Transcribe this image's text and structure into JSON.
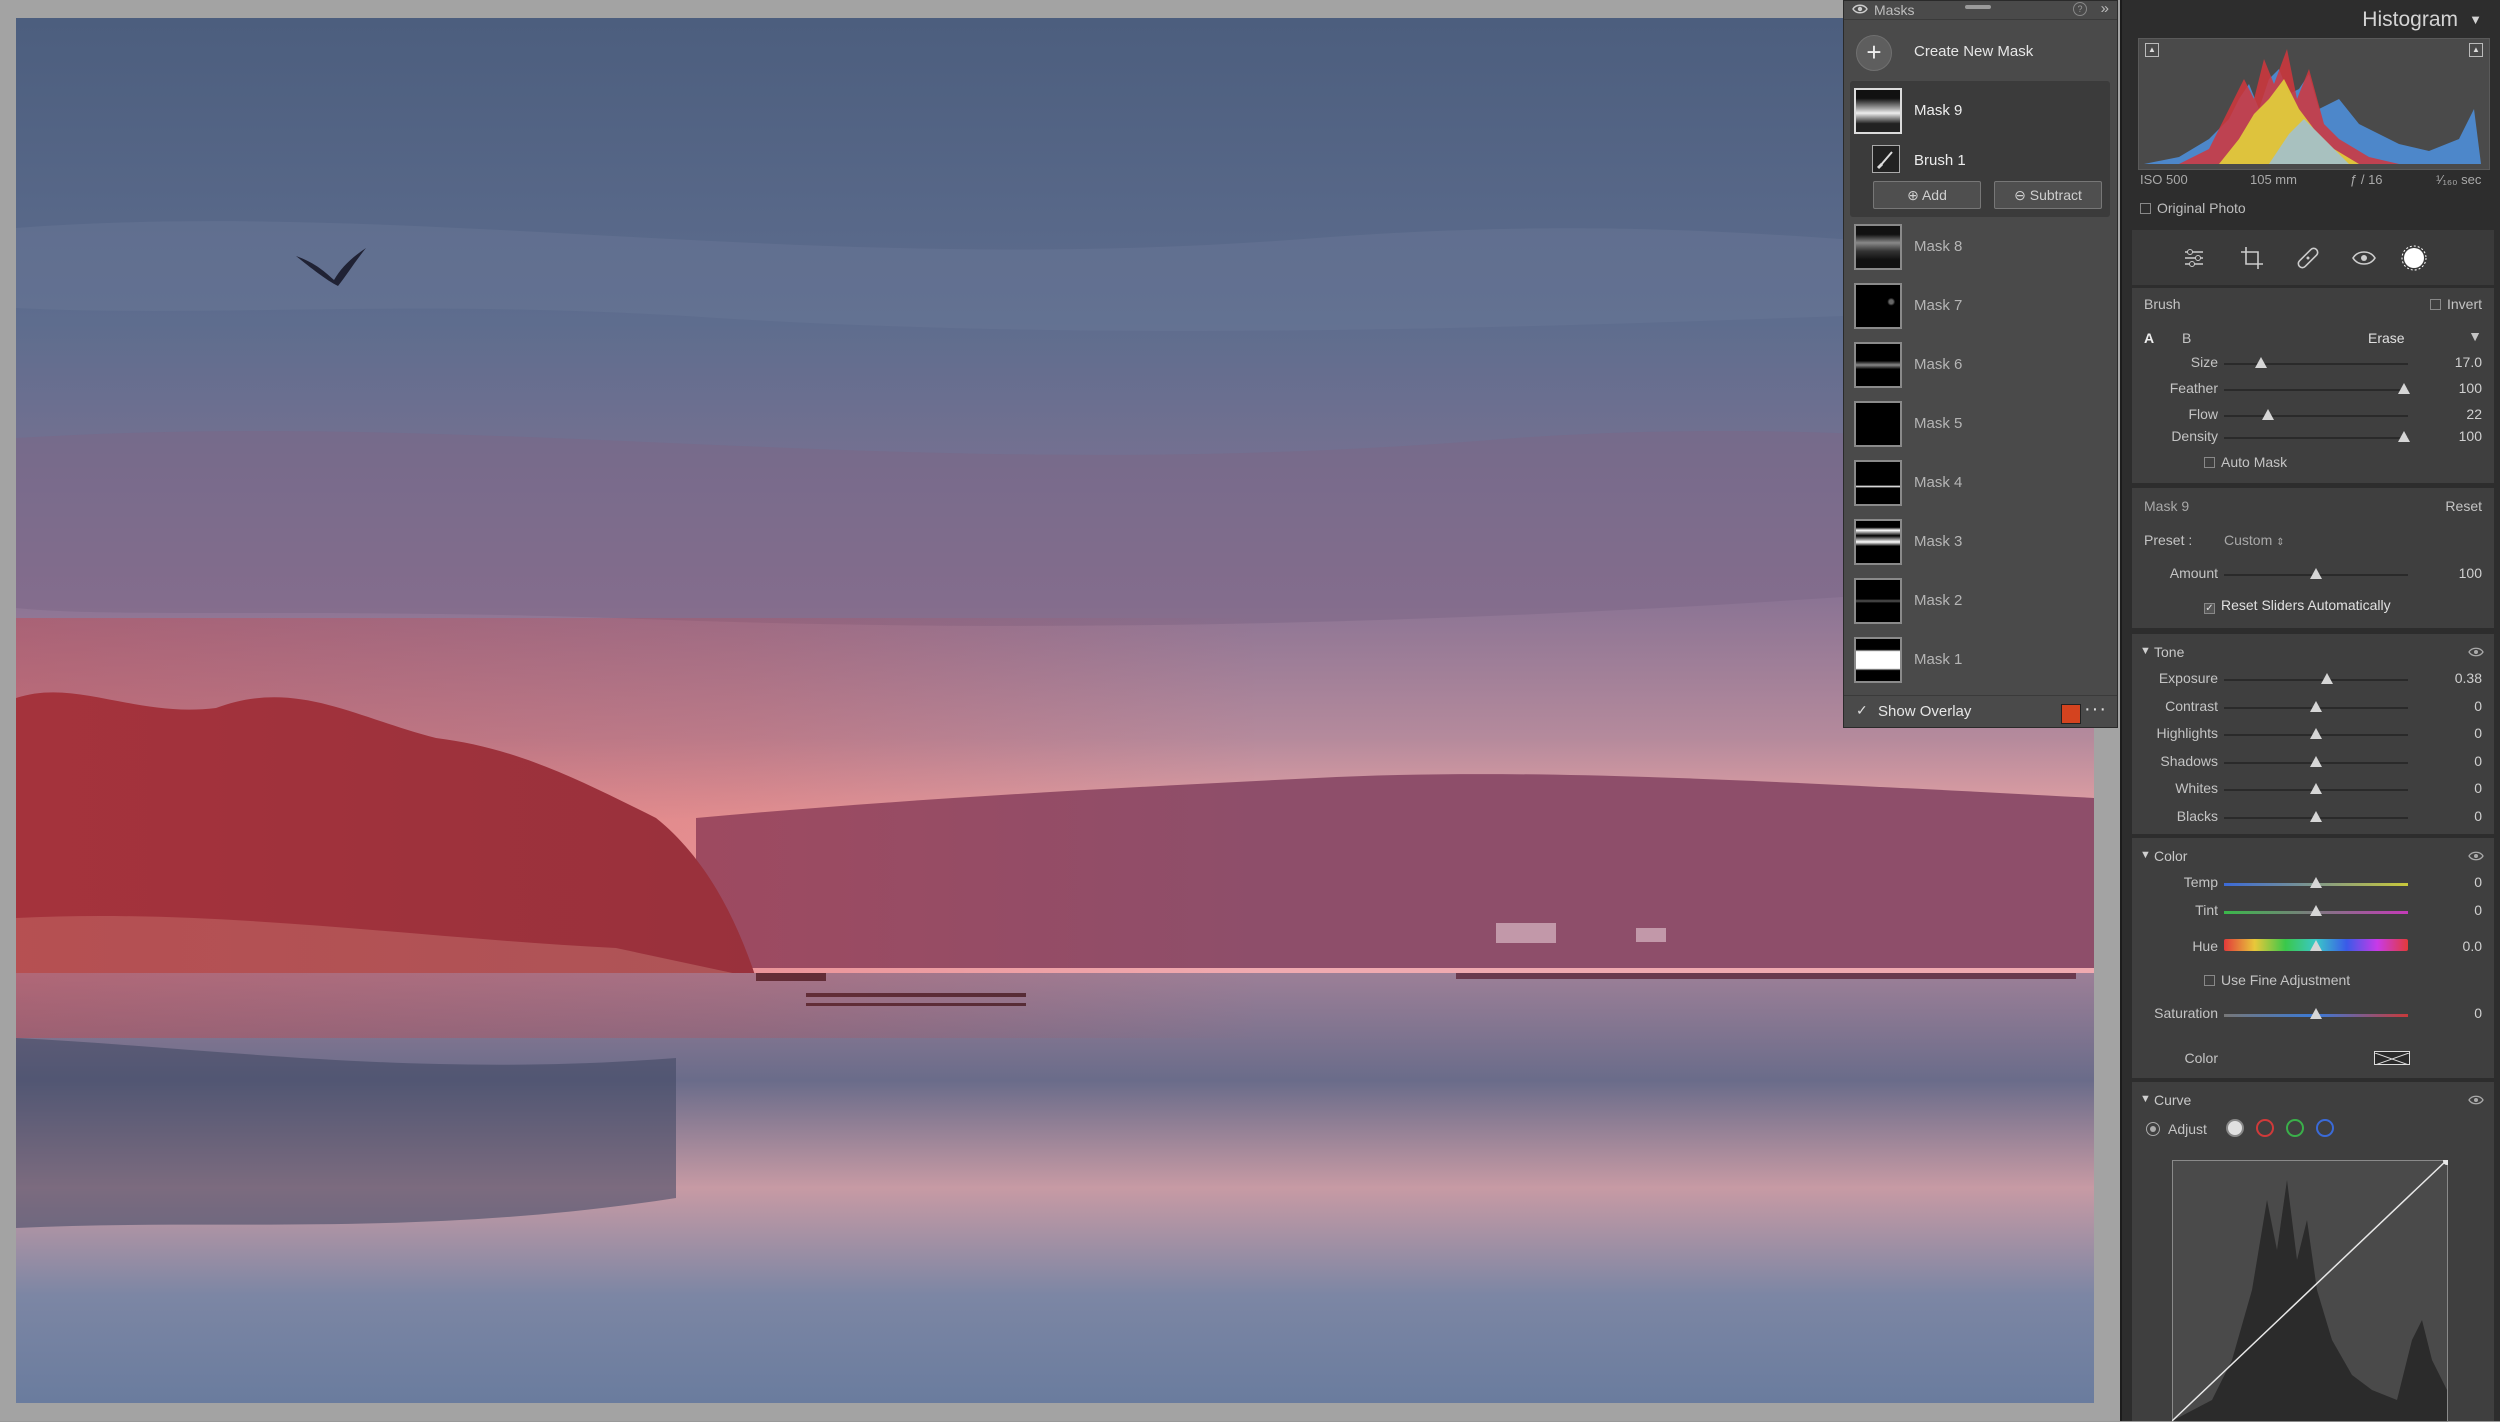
{
  "masks_panel": {
    "title": "Masks",
    "create_label": "Create New Mask",
    "selected_mask": "Mask 9",
    "brush_label": "Brush 1",
    "add_label": "Add",
    "subtract_label": "Subtract",
    "masks": [
      "Mask 8",
      "Mask 7",
      "Mask 6",
      "Mask 5",
      "Mask 4",
      "Mask 3",
      "Mask 2",
      "Mask 1"
    ],
    "show_overlay_label": "Show Overlay",
    "overlay_color": "#d4431f",
    "more_label": "···"
  },
  "histogram": {
    "title": "Histogram",
    "iso": "ISO 500",
    "focal": "105 mm",
    "aperture": "ƒ / 16",
    "shutter": "¹⁄₁₆₀ sec",
    "original_photo_label": "Original Photo"
  },
  "brush": {
    "title": "Brush",
    "invert_label": "Invert",
    "tab_a": "A",
    "tab_b": "B",
    "erase_label": "Erase",
    "size_label": "Size",
    "size_value": "17.0",
    "size_pos": 0.2,
    "feather_label": "Feather",
    "feather_value": "100",
    "feather_pos": 0.98,
    "flow_label": "Flow",
    "flow_value": "22",
    "flow_pos": 0.24,
    "density_label": "Density",
    "density_value": "100",
    "density_pos": 0.98,
    "auto_mask_label": "Auto Mask"
  },
  "mask_settings": {
    "name": "Mask 9",
    "reset_label": "Reset",
    "preset_label": "Preset :",
    "preset_value": "Custom",
    "amount_label": "Amount",
    "amount_value": "100",
    "reset_sliders_label": "Reset Sliders Automatically"
  },
  "tone": {
    "title": "Tone",
    "sliders": [
      {
        "label": "Exposure",
        "value": "0.38"
      },
      {
        "label": "Contrast",
        "value": "0"
      },
      {
        "label": "Highlights",
        "value": "0"
      },
      {
        "label": "Shadows",
        "value": "0"
      },
      {
        "label": "Whites",
        "value": "0"
      },
      {
        "label": "Blacks",
        "value": "0"
      }
    ]
  },
  "color": {
    "title": "Color",
    "temp_label": "Temp",
    "temp_value": "0",
    "tint_label": "Tint",
    "tint_value": "0",
    "hue_label": "Hue",
    "hue_value": "0.0",
    "fine_label": "Use Fine Adjustment",
    "saturation_label": "Saturation",
    "saturation_value": "0",
    "color_label": "Color"
  },
  "curve": {
    "title": "Curve",
    "adjust_label": "Adjust"
  }
}
